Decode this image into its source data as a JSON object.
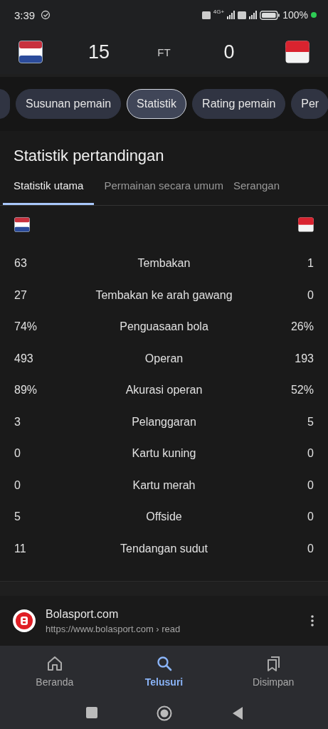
{
  "status_bar": {
    "time": "3:39",
    "network": "4G+",
    "battery": "100%"
  },
  "score": {
    "home": "15",
    "status": "FT",
    "away": "0"
  },
  "chips": [
    {
      "kind": "clipped",
      "selected": false
    },
    {
      "kind": "chip",
      "label": "Susunan pemain",
      "selected": false
    },
    {
      "kind": "chip",
      "label": "Statistik",
      "selected": true
    },
    {
      "kind": "chip",
      "label": "Rating pemain",
      "selected": false
    },
    {
      "kind": "chip",
      "label": "Per",
      "selected": false
    }
  ],
  "card": {
    "title": "Statistik pertandingan",
    "tabs": [
      {
        "label": "Statistik utama",
        "selected": true
      },
      {
        "label": "Permainan secara umum",
        "selected": false
      },
      {
        "label": "Serangan",
        "selected": false
      }
    ],
    "stats": [
      {
        "home": "63",
        "name": "Tembakan",
        "away": "1"
      },
      {
        "home": "27",
        "name": "Tembakan ke arah gawang",
        "away": "0"
      },
      {
        "home": "74%",
        "name": "Penguasaan bola",
        "away": "26%"
      },
      {
        "home": "493",
        "name": "Operan",
        "away": "193"
      },
      {
        "home": "89%",
        "name": "Akurasi operan",
        "away": "52%"
      },
      {
        "home": "3",
        "name": "Pelanggaran",
        "away": "5"
      },
      {
        "home": "0",
        "name": "Kartu kuning",
        "away": "0"
      },
      {
        "home": "0",
        "name": "Kartu merah",
        "away": "0"
      },
      {
        "home": "5",
        "name": "Offside",
        "away": "0"
      },
      {
        "home": "11",
        "name": "Tendangan sudut",
        "away": "0"
      }
    ]
  },
  "source": {
    "name": "Bolasport.com",
    "url": "https://www.bolasport.com › read"
  },
  "bottom_nav": [
    {
      "kind": "home",
      "label": "Beranda",
      "selected": false
    },
    {
      "kind": "search",
      "label": "Telusuri",
      "selected": true
    },
    {
      "kind": "saved",
      "label": "Disimpan",
      "selected": false
    }
  ]
}
